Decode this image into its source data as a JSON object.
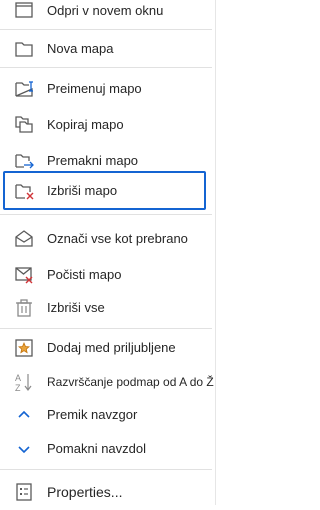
{
  "menu": {
    "items": [
      {
        "label": "Odpri v novem oknu",
        "icon": "open-new-window-icon"
      },
      {
        "label": "Nova mapa",
        "icon": "new-folder-icon"
      },
      {
        "label": "Preimenuj mapo",
        "icon": "rename-folder-icon"
      },
      {
        "label": "Kopiraj mapo",
        "icon": "copy-folder-icon"
      },
      {
        "label": "Premakni mapo",
        "icon": "move-folder-icon"
      },
      {
        "label": "Izbriši mapo",
        "icon": "delete-folder-icon"
      },
      {
        "label": "Označi vse kot prebrano",
        "icon": "mark-all-read-icon"
      },
      {
        "label": "Počisti mapo",
        "icon": "clean-folder-icon"
      },
      {
        "label": "Izbriši vse",
        "icon": "delete-all-icon"
      },
      {
        "label": "Dodaj med priljubljene",
        "icon": "add-favorites-icon"
      },
      {
        "label": "Razvrščanje podmap od A do Ž",
        "icon": "sort-az-icon"
      },
      {
        "label": "Premik navzgor",
        "icon": "chevron-up-icon"
      },
      {
        "label": "Pomakni navzdol",
        "icon": "chevron-down-icon"
      },
      {
        "label": "Properties...",
        "icon": "properties-icon"
      }
    ]
  },
  "colors": {
    "accent": "#1464d2",
    "delete_red": "#d13438",
    "favorite_orange": "#c4730a",
    "icon_gray": "#5a5a5a"
  }
}
